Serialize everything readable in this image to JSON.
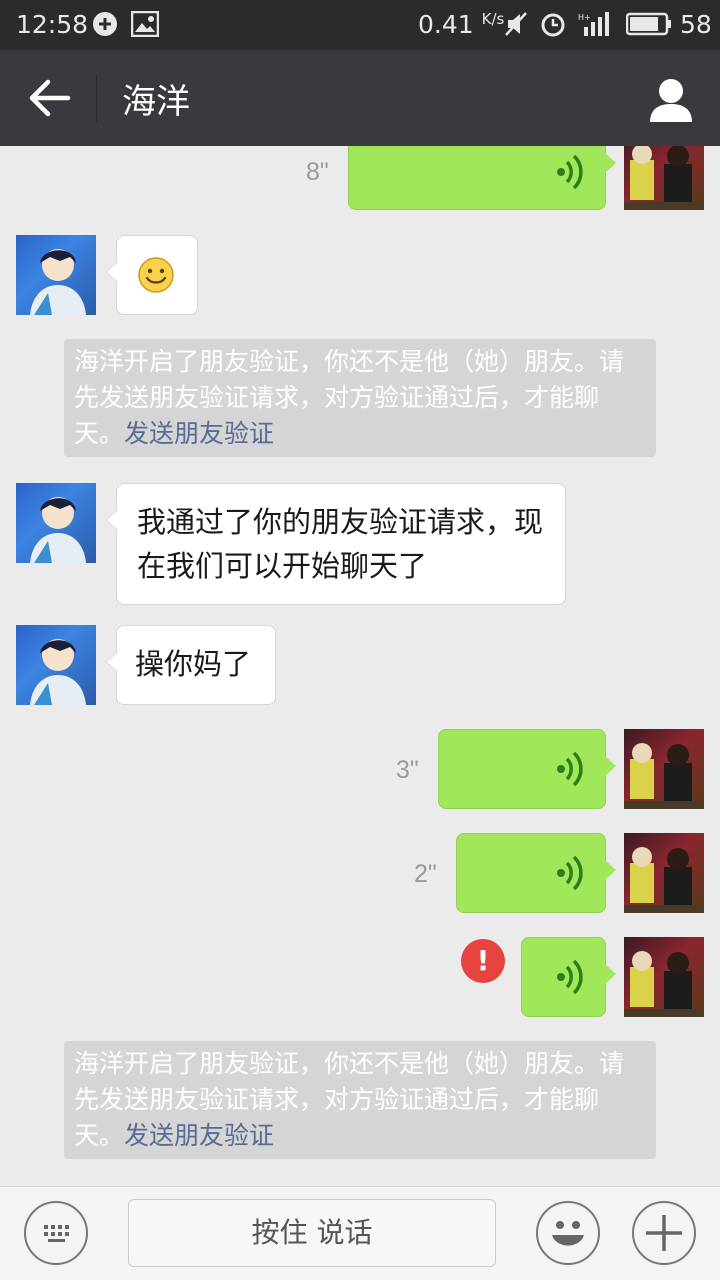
{
  "status_bar": {
    "time": "12:58",
    "net_speed": "0.41",
    "net_unit": "K/s",
    "battery": "58"
  },
  "header": {
    "title": "海洋"
  },
  "messages": {
    "voice1_duration": "8\"",
    "emoji": "😊",
    "note1_text": "海洋开启了朋友验证，你还不是他（她）朋友。请先发送朋友验证请求，对方验证通过后，才能聊天。",
    "note1_link": "发送朋友验证",
    "text1": "我通过了你的朋友验证请求，现在我们可以开始聊天了",
    "text2": "操你妈了",
    "voice2_duration": "3\"",
    "voice3_duration": "2\"",
    "voice4_error": "!",
    "note2_text": "海洋开启了朋友验证，你还不是他（她）朋友。请先发送朋友验证请求，对方验证通过后，才能聊天。",
    "note2_link": "发送朋友验证"
  },
  "input_bar": {
    "hold_to_talk": "按住 说话"
  },
  "colors": {
    "header_bg": "#393a3f",
    "chat_bg": "#ebebeb",
    "sent_bubble": "#a0e75a",
    "link": "#576b95",
    "error": "#e64340"
  },
  "icons": [
    "back-arrow-icon",
    "person-icon",
    "keyboard-icon",
    "emoji-icon",
    "plus-icon",
    "voice-wave-icon",
    "error-icon"
  ]
}
